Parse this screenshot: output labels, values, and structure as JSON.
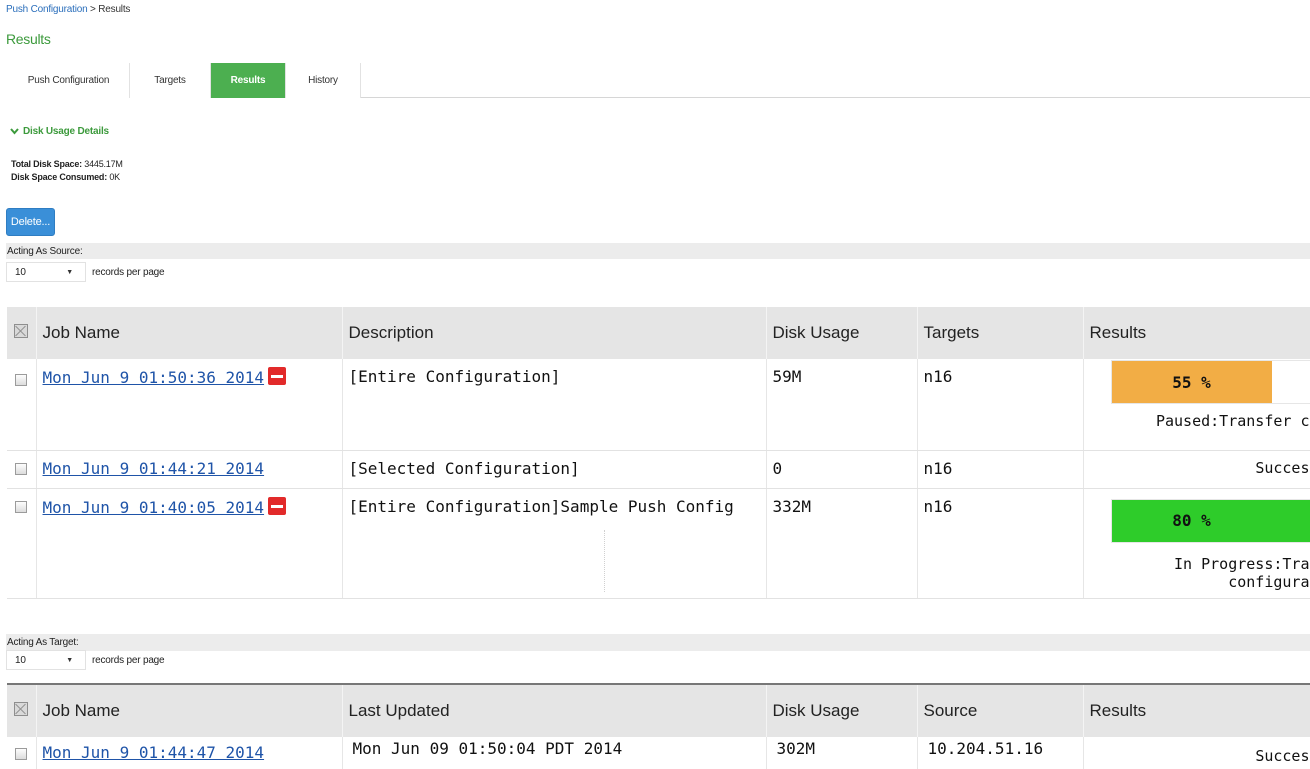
{
  "breadcrumb": {
    "link": "Push Configuration",
    "separator": " > ",
    "current": "Results"
  },
  "page_title": "Results",
  "tabs": [
    {
      "label": "Push Configuration",
      "active": false
    },
    {
      "label": "Targets",
      "active": false
    },
    {
      "label": "Results",
      "active": true
    },
    {
      "label": "History",
      "active": false
    }
  ],
  "disk": {
    "header": "Disk Usage Details",
    "total_label": "Total Disk Space:",
    "total_value": "3445.17M",
    "consumed_label": "Disk Space Consumed:",
    "consumed_value": "0K"
  },
  "delete_label": "Delete...",
  "source": {
    "section_label": "Acting As Source:",
    "per_page": "10",
    "per_page_suffix": "records per page",
    "columns": [
      "Job Name",
      "Description",
      "Disk Usage",
      "Targets",
      "Results"
    ],
    "rows": [
      {
        "job": "Mon Jun 9 01:50:36 2014",
        "stoppable": true,
        "description": "[Entire Configuration]",
        "disk": "59M",
        "targets": "n16",
        "progress": 55,
        "progress_label": "55 %",
        "progress_color": "#f2ad45",
        "status": "Paused:Transfer c"
      },
      {
        "job": "Mon Jun 9 01:44:21 2014",
        "stoppable": false,
        "description": "[Selected Configuration]",
        "disk": "0",
        "targets": "n16",
        "status": "Succes"
      },
      {
        "job": "Mon Jun 9 01:40:05 2014",
        "stoppable": true,
        "description": "[Entire Configuration]Sample Push Config",
        "disk": "332M",
        "targets": "n16",
        "progress": 80,
        "progress_label": "80 %",
        "progress_color": "#2ecc2a",
        "status": "In Progress:Tra",
        "status2": "configura"
      }
    ]
  },
  "target": {
    "section_label": "Acting As Target:",
    "per_page": "10",
    "per_page_suffix": "records per page",
    "columns": [
      "Job Name",
      "Last Updated",
      "Disk Usage",
      "Source",
      "Results"
    ],
    "rows": [
      {
        "job": "Mon Jun 9 01:44:47 2014",
        "updated": "Mon Jun 09 01:50:04 PDT 2014",
        "disk": "302M",
        "source": "10.204.51.16",
        "status": "Succes"
      }
    ]
  },
  "colors": {
    "accent_green": "#4caf50",
    "title_green": "#3c9a3c",
    "link_blue": "#1f54a8",
    "button_blue": "#3a8fd8",
    "stop_red": "#e22a2a"
  }
}
